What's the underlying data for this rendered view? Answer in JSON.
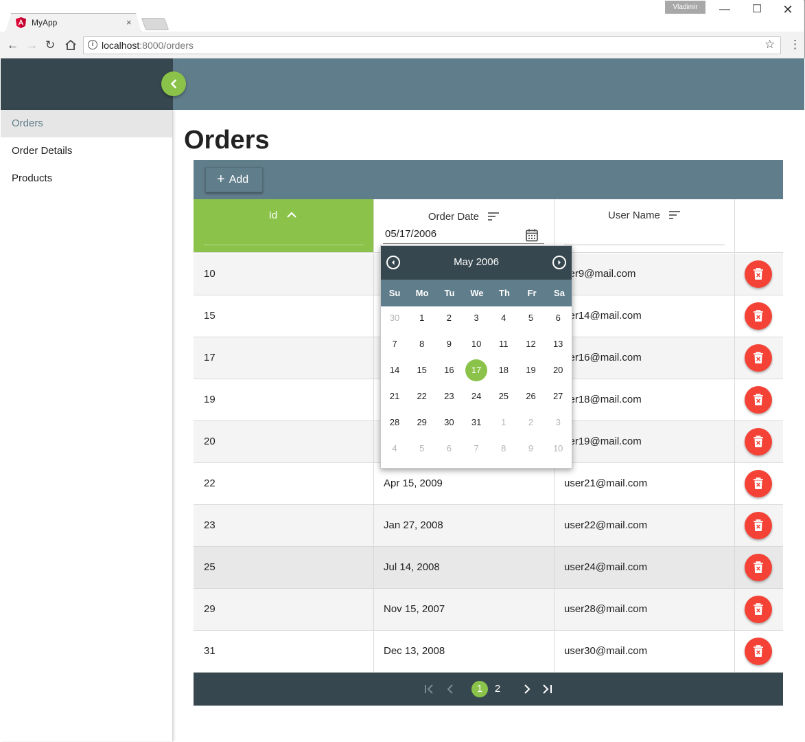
{
  "browser": {
    "tab_title": "MyApp",
    "profile_name": "Vladimir",
    "url_host": "localhost",
    "url_rest": ":8000/orders",
    "favicon_color": "#dd0031"
  },
  "sidebar": {
    "items": [
      {
        "label": "Orders",
        "active": true
      },
      {
        "label": "Order Details",
        "active": false
      },
      {
        "label": "Products",
        "active": false
      }
    ]
  },
  "page": {
    "title": "Orders"
  },
  "grid": {
    "add_label": "Add",
    "columns": {
      "id": "Id",
      "order_date": "Order Date",
      "user_name": "User Name"
    },
    "date_filter_value": "05/17/2006",
    "rows": [
      {
        "id": "10",
        "date": "",
        "user": "user9@mail.com",
        "user_visible": "ser9@mail.com"
      },
      {
        "id": "15",
        "date": "",
        "user": "user14@mail.com",
        "user_visible": "ser14@mail.com"
      },
      {
        "id": "17",
        "date": "",
        "user": "user16@mail.com",
        "user_visible": "ser16@mail.com"
      },
      {
        "id": "19",
        "date": "",
        "user": "user18@mail.com",
        "user_visible": "ser18@mail.com"
      },
      {
        "id": "20",
        "date": "",
        "user": "user19@mail.com",
        "user_visible": "ser19@mail.com"
      },
      {
        "id": "22",
        "date": "Apr 15, 2009",
        "user": "user21@mail.com",
        "user_visible": "user21@mail.com"
      },
      {
        "id": "23",
        "date": "Jan 27, 2008",
        "user": "user22@mail.com",
        "user_visible": "user22@mail.com"
      },
      {
        "id": "25",
        "date": "Jul 14, 2008",
        "user": "user24@mail.com",
        "user_visible": "user24@mail.com"
      },
      {
        "id": "29",
        "date": "Nov 15, 2007",
        "user": "user28@mail.com",
        "user_visible": "user28@mail.com"
      },
      {
        "id": "31",
        "date": "Dec 13, 2008",
        "user": "user30@mail.com",
        "user_visible": "user30@mail.com"
      }
    ],
    "pager": {
      "pages": [
        "1",
        "2"
      ],
      "current": "1"
    }
  },
  "calendar": {
    "month_label": "May 2006",
    "weekdays": [
      "Su",
      "Mo",
      "Tu",
      "We",
      "Th",
      "Fr",
      "Sa"
    ],
    "weeks": [
      [
        "30",
        "1",
        "2",
        "3",
        "4",
        "5",
        "6"
      ],
      [
        "7",
        "8",
        "9",
        "10",
        "11",
        "12",
        "13"
      ],
      [
        "14",
        "15",
        "16",
        "17",
        "18",
        "19",
        "20"
      ],
      [
        "21",
        "22",
        "23",
        "24",
        "25",
        "26",
        "27"
      ],
      [
        "28",
        "29",
        "30",
        "31",
        "1",
        "2",
        "3"
      ],
      [
        "4",
        "5",
        "6",
        "7",
        "8",
        "9",
        "10"
      ]
    ],
    "selected": "17"
  },
  "colors": {
    "accent": "#8bc34a",
    "primary": "#607d8b",
    "dark": "#37474f",
    "danger": "#f44336"
  }
}
